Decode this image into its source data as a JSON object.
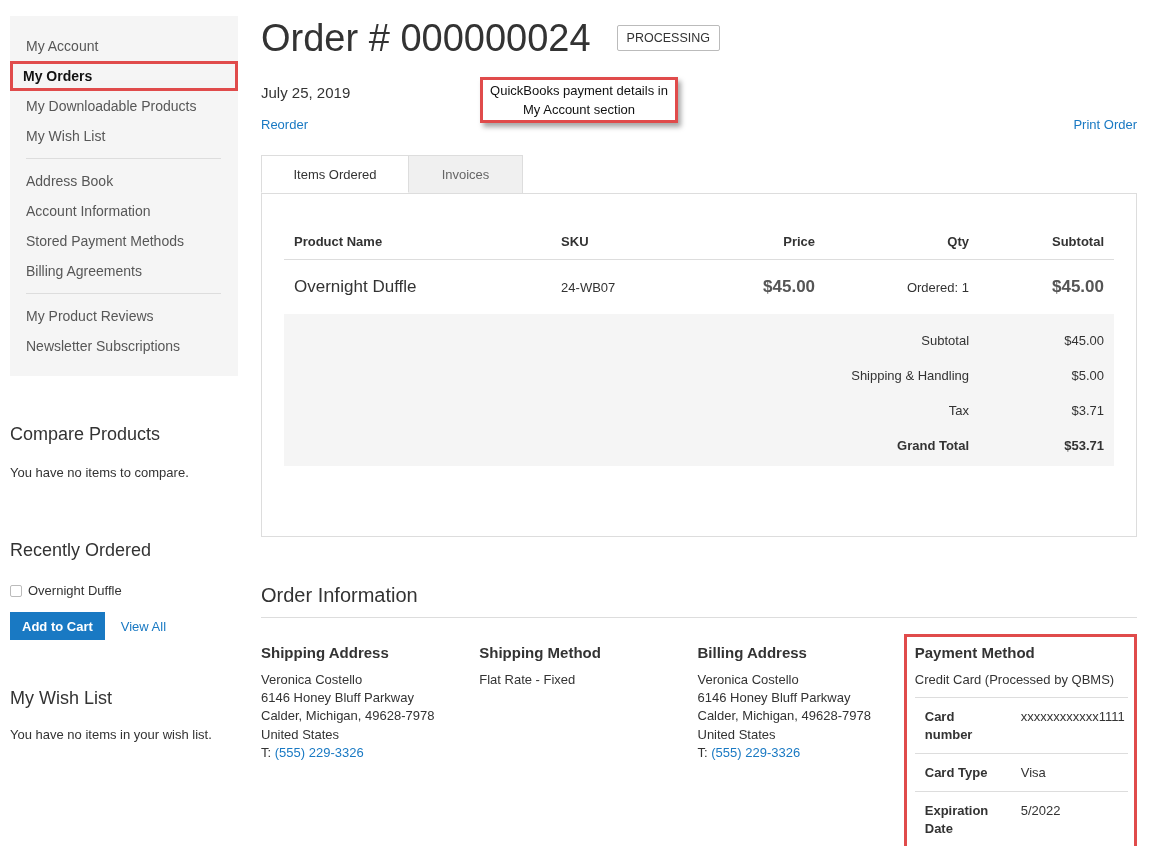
{
  "sidebar": {
    "nav_groups": [
      [
        {
          "label": "My Account",
          "selected": false,
          "highlighted": false
        },
        {
          "label": "My Orders",
          "selected": true,
          "highlighted": true
        },
        {
          "label": "My Downloadable Products",
          "selected": false,
          "highlighted": false
        },
        {
          "label": "My Wish List",
          "selected": false,
          "highlighted": false
        }
      ],
      [
        {
          "label": "Address Book",
          "selected": false,
          "highlighted": false
        },
        {
          "label": "Account Information",
          "selected": false,
          "highlighted": false
        },
        {
          "label": "Stored Payment Methods",
          "selected": false,
          "highlighted": false
        },
        {
          "label": "Billing Agreements",
          "selected": false,
          "highlighted": false
        }
      ],
      [
        {
          "label": "My Product Reviews",
          "selected": false,
          "highlighted": false
        },
        {
          "label": "Newsletter Subscriptions",
          "selected": false,
          "highlighted": false
        }
      ]
    ],
    "compare": {
      "title": "Compare Products",
      "message": "You have no items to compare."
    },
    "recently_ordered": {
      "title": "Recently Ordered",
      "items": [
        {
          "label": "Overnight Duffle",
          "checked": false
        }
      ],
      "add_button": "Add to Cart",
      "view_all": "View All"
    },
    "wish_list": {
      "title": "My Wish List",
      "message": "You have no items in your wish list."
    }
  },
  "order": {
    "title": "Order # 000000024",
    "status": "PROCESSING",
    "date": "July 25, 2019",
    "reorder": "Reorder",
    "print": "Print Order",
    "callout": "QuickBooks payment details in My Account section",
    "tabs": [
      {
        "label": "Items Ordered",
        "selected": true
      },
      {
        "label": "Invoices",
        "selected": false
      }
    ],
    "table": {
      "columns": [
        "Product Name",
        "SKU",
        "Price",
        "Qty",
        "Subtotal"
      ],
      "rows": [
        {
          "name": "Overnight Duffle",
          "sku": "24-WB07",
          "price": "$45.00",
          "qty": "Ordered: 1",
          "subtotal": "$45.00"
        }
      ],
      "totals": [
        {
          "label": "Subtotal",
          "value": "$45.00",
          "kind": "normal"
        },
        {
          "label": "Shipping & Handling",
          "value": "$5.00",
          "kind": "normal"
        },
        {
          "label": "Tax",
          "value": "$3.71",
          "kind": "normal"
        },
        {
          "label": "Grand Total",
          "value": "$53.71",
          "kind": "grand"
        }
      ]
    }
  },
  "order_information": {
    "title": "Order Information",
    "blocks": [
      {
        "title": "Shipping Address",
        "lines": [
          "Veronica Costello",
          "6146 Honey Bluff Parkway",
          "Calder, Michigan, 49628-7978",
          "United States"
        ],
        "phone_prefix": "T:",
        "phone": "(555) 229-3326"
      },
      {
        "title": "Shipping Method",
        "lines": [
          "Flat Rate - Fixed"
        ]
      },
      {
        "title": "Billing Address",
        "lines": [
          "Veronica Costello",
          "6146 Honey Bluff Parkway",
          "Calder, Michigan, 49628-7978",
          "United States"
        ],
        "phone_prefix": "T:",
        "phone": "(555) 229-3326"
      }
    ],
    "payment": {
      "title": "Payment Method",
      "method": "Credit Card (Processed by QBMS)",
      "highlighted": true,
      "details": [
        {
          "label": "Card number",
          "value": "xxxxxxxxxxxx1111"
        },
        {
          "label": "Card Type",
          "value": "Visa"
        },
        {
          "label": "Expiration Date",
          "value": "5/2022"
        }
      ]
    }
  }
}
